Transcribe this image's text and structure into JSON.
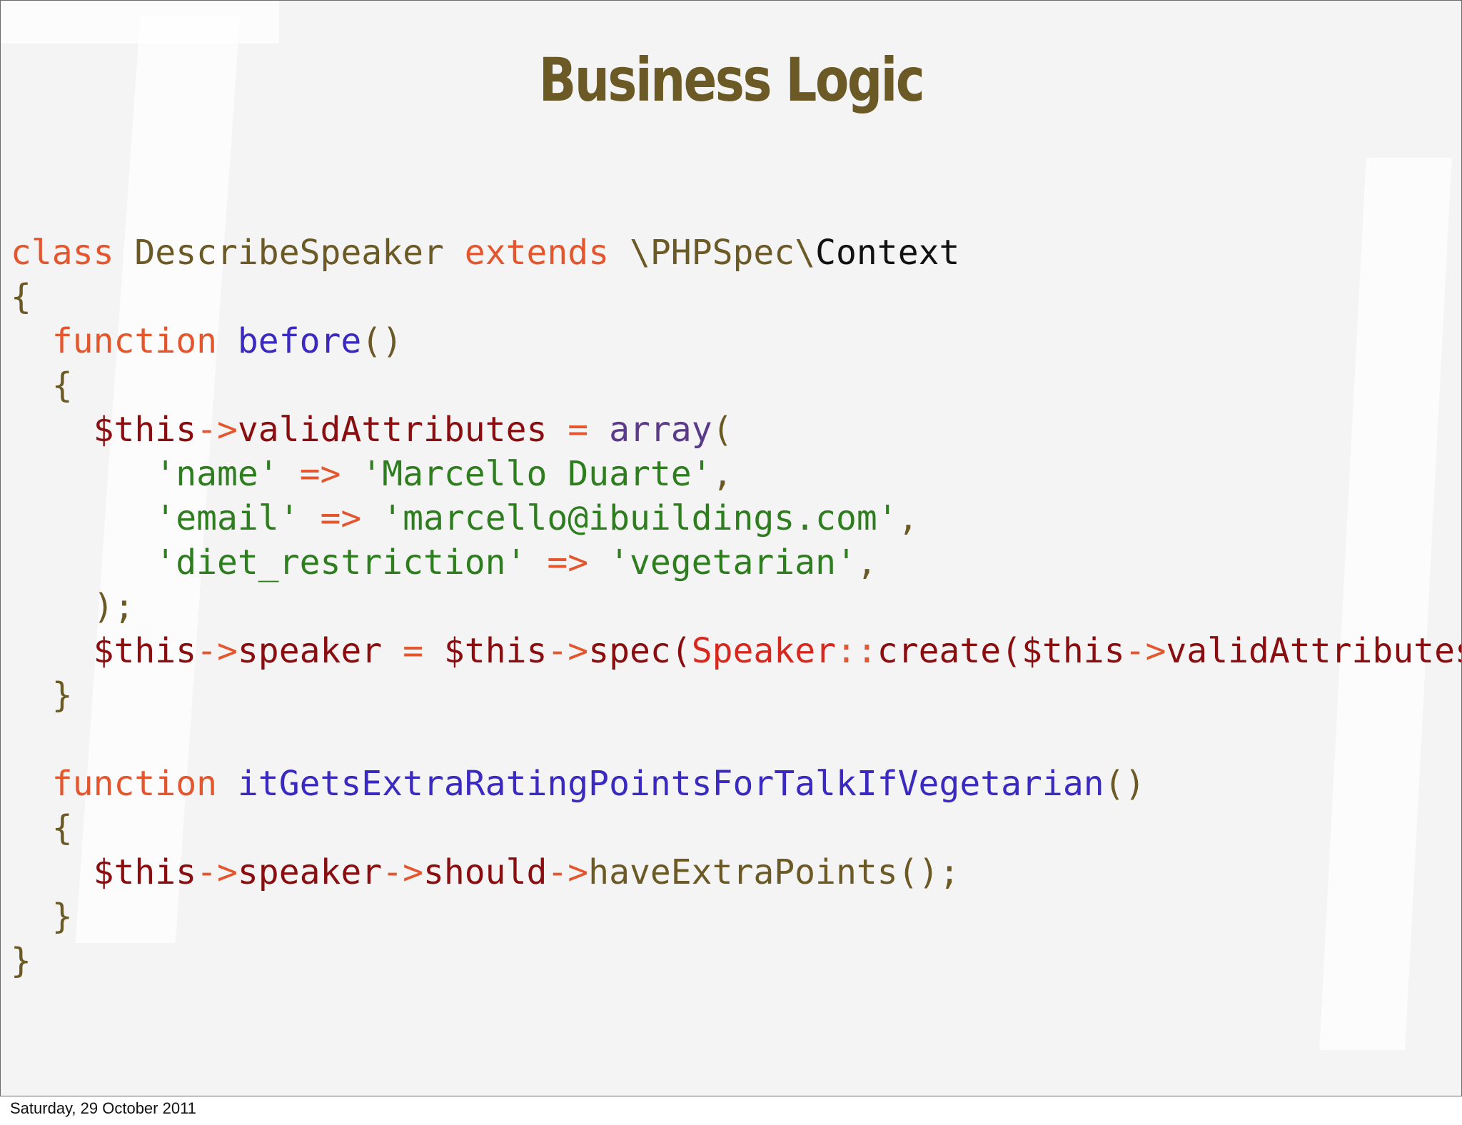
{
  "slide": {
    "title": "Business Logic",
    "footer_date": "Saturday, 29 October 2011"
  },
  "colors": {
    "title": "#6b5a26",
    "keyword": "#e4572e",
    "class_name": "#6b5a26",
    "function_name": "#3a2ac0",
    "variable": "#8a0d10",
    "string": "#2e7d1e",
    "background": "#f4f4f4"
  },
  "code": {
    "language": "PHP",
    "lines": [
      [
        [
          "class",
          "kw"
        ],
        [
          " ",
          "ol"
        ],
        [
          "DescribeSpeaker",
          "cls"
        ],
        [
          " ",
          "ol"
        ],
        [
          "extends",
          "kw"
        ],
        [
          " ",
          "ol"
        ],
        [
          "\\PHPSpec\\",
          "cls"
        ],
        [
          "Context",
          "blk"
        ]
      ],
      [
        [
          "{",
          "ol"
        ]
      ],
      [
        [
          "  ",
          "ol"
        ],
        [
          "function",
          "kw"
        ],
        [
          " ",
          "ol"
        ],
        [
          "before",
          "fn"
        ],
        [
          "()",
          "ol"
        ]
      ],
      [
        [
          "  ",
          "ol"
        ],
        [
          "{",
          "ol"
        ]
      ],
      [
        [
          "    ",
          "ol"
        ],
        [
          "$this",
          "var"
        ],
        [
          "->",
          "kw"
        ],
        [
          "validAttributes",
          "var"
        ],
        [
          " ",
          "ol"
        ],
        [
          "=",
          "kw"
        ],
        [
          " ",
          "ol"
        ],
        [
          "array",
          "arr"
        ],
        [
          "(",
          "ol"
        ]
      ],
      [
        [
          "       ",
          "ol"
        ],
        [
          "'name'",
          "str"
        ],
        [
          " ",
          "ol"
        ],
        [
          "=>",
          "kw"
        ],
        [
          " ",
          "ol"
        ],
        [
          "'Marcello Duarte'",
          "str"
        ],
        [
          ",",
          "ol"
        ]
      ],
      [
        [
          "       ",
          "ol"
        ],
        [
          "'email'",
          "str"
        ],
        [
          " ",
          "ol"
        ],
        [
          "=>",
          "kw"
        ],
        [
          " ",
          "ol"
        ],
        [
          "'marcello@ibuildings.com'",
          "str"
        ],
        [
          ",",
          "ol"
        ]
      ],
      [
        [
          "       ",
          "ol"
        ],
        [
          "'diet_restriction'",
          "str"
        ],
        [
          " ",
          "ol"
        ],
        [
          "=>",
          "kw"
        ],
        [
          " ",
          "ol"
        ],
        [
          "'vegetarian'",
          "str"
        ],
        [
          ",",
          "ol"
        ]
      ],
      [
        [
          "    ",
          "ol"
        ],
        [
          ");",
          "ol"
        ]
      ],
      [
        [
          "    ",
          "ol"
        ],
        [
          "$this",
          "var"
        ],
        [
          "->",
          "kw"
        ],
        [
          "speaker",
          "var"
        ],
        [
          " ",
          "ol"
        ],
        [
          "=",
          "kw"
        ],
        [
          " ",
          "ol"
        ],
        [
          "$this",
          "var"
        ],
        [
          "->",
          "kw"
        ],
        [
          "spec(",
          "var"
        ],
        [
          "Speaker",
          "red"
        ],
        [
          "::",
          "kw"
        ],
        [
          "create(",
          "var"
        ],
        [
          "$this",
          "var"
        ],
        [
          "->",
          "kw"
        ],
        [
          "validAttributes",
          "var"
        ],
        [
          "));",
          "ol"
        ]
      ],
      [
        [
          "  ",
          "ol"
        ],
        [
          "}",
          "ol"
        ]
      ],
      [],
      [
        [
          "  ",
          "ol"
        ],
        [
          "function",
          "kw"
        ],
        [
          " ",
          "ol"
        ],
        [
          "itGetsExtraRatingPointsForTalkIfVegetarian",
          "fn"
        ],
        [
          "()",
          "ol"
        ]
      ],
      [
        [
          "  ",
          "ol"
        ],
        [
          "{",
          "ol"
        ]
      ],
      [
        [
          "    ",
          "ol"
        ],
        [
          "$this",
          "var"
        ],
        [
          "->",
          "kw"
        ],
        [
          "speaker",
          "var"
        ],
        [
          "->",
          "kw"
        ],
        [
          "should",
          "var"
        ],
        [
          "->",
          "kw"
        ],
        [
          "haveExtraPoints();",
          "ol"
        ]
      ],
      [
        [
          "  ",
          "ol"
        ],
        [
          "}",
          "ol"
        ]
      ],
      [
        [
          "}",
          "ol"
        ]
      ]
    ]
  }
}
